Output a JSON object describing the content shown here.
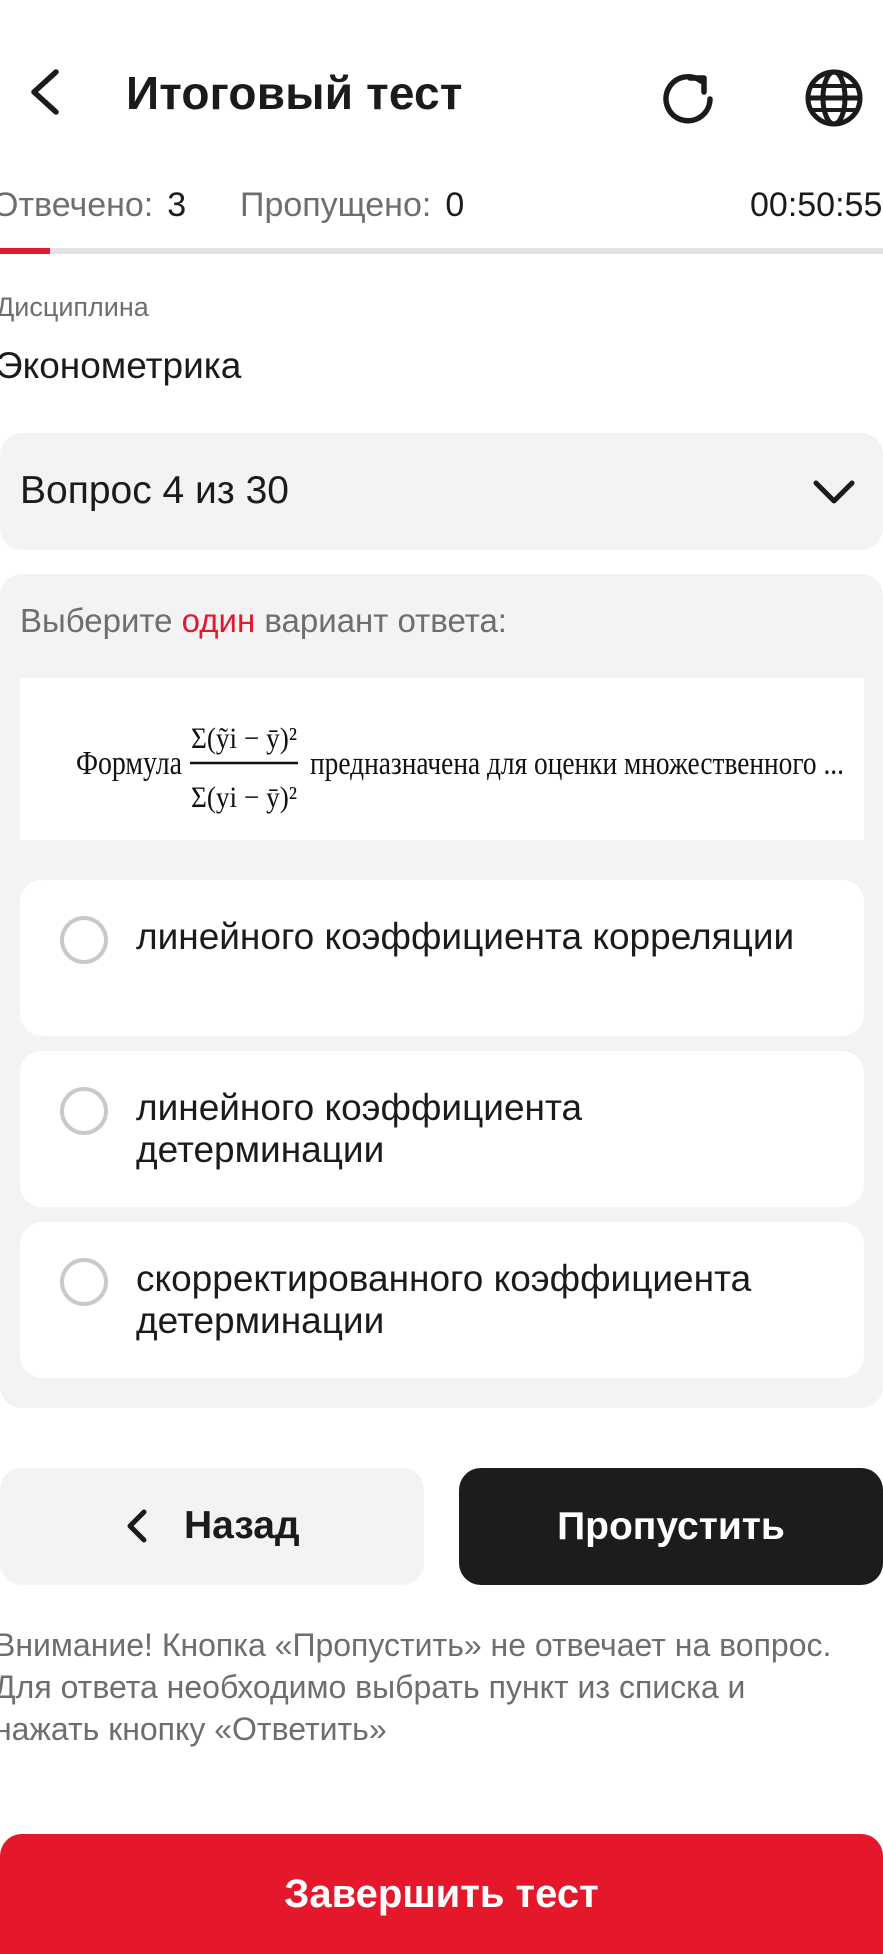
{
  "header": {
    "title": "Итоговый тест"
  },
  "stats": {
    "answered_label": "Отвечено:",
    "answered_count": "3",
    "skipped_label": "Пропущено:",
    "skipped_count": "0",
    "timer": "00:50:55"
  },
  "progress": {
    "answered": 3,
    "total": 30,
    "fill_color": "#e3182d"
  },
  "discipline": {
    "label": "Дисциплина",
    "name": "Эконометрика"
  },
  "question_select": {
    "label": "Вопрос 4 из 30"
  },
  "question": {
    "instruction_before": "Выберите",
    "instruction_accent": "один",
    "instruction_after": "вариант ответа:",
    "formula": {
      "prefix": "Формула",
      "numerator": "Σ(ỹi − ȳ)²",
      "denominator": "Σ(yi − ȳ)²",
      "suffix": "предназначена для оценки множественного ..."
    },
    "options": [
      {
        "text": "линейного коэффициента корреляции"
      },
      {
        "text": "линейного коэффициента детерминации"
      },
      {
        "text": "скорректированного коэффициента детерминации"
      }
    ]
  },
  "buttons": {
    "back_label": "Назад",
    "skip_label": "Пропустить",
    "finish_label": "Завершить тест"
  },
  "notice": "Внимание! Кнопка «Пропустить» не отвечает на вопрос. Для ответа необходимо выбрать пункт из списка и нажать кнопку «Ответить»",
  "colors": {
    "accent": "#e3182d",
    "dark_button": "#1c1c1c",
    "card_background": "#f3f3f3"
  }
}
